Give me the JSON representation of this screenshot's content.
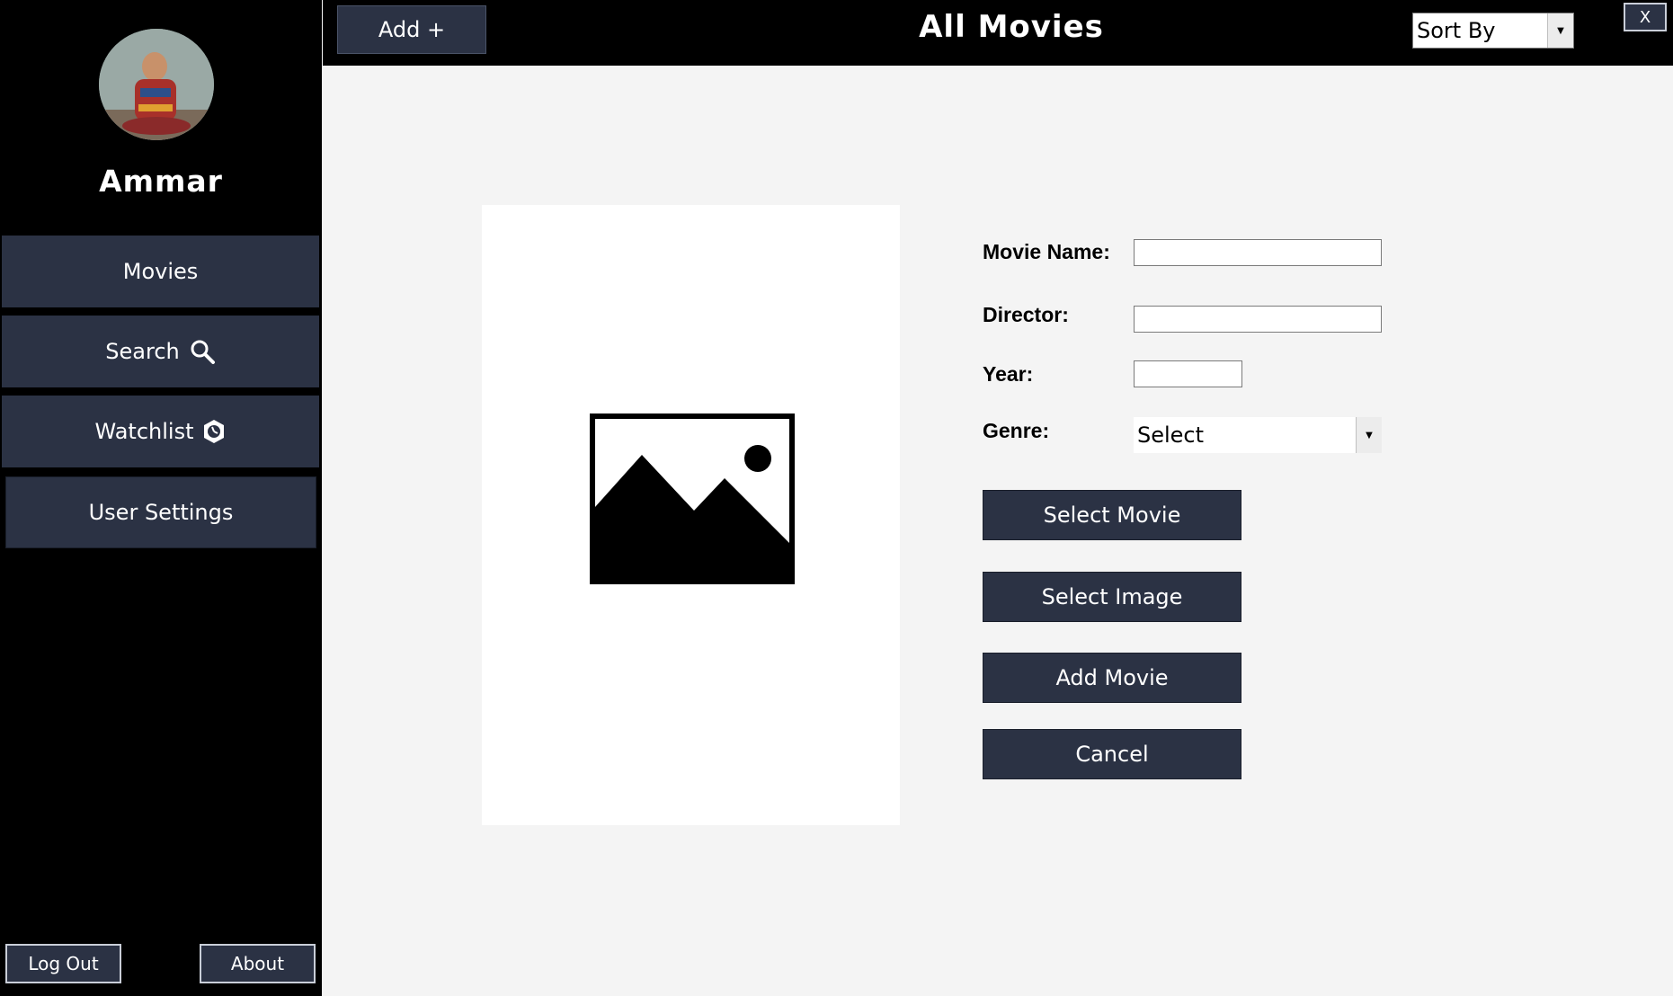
{
  "sidebar": {
    "username": "Ammar",
    "nav": {
      "movies": "Movies",
      "search": "Search",
      "watchlist": "Watchlist",
      "user_settings": "User Settings"
    },
    "logout": "Log Out",
    "about": "About"
  },
  "header": {
    "add_button": "Add +",
    "title": "All Movies",
    "sort_by": "Sort By",
    "close": "X"
  },
  "form": {
    "movie_name_label": "Movie Name:",
    "director_label": "Director:",
    "year_label": "Year:",
    "genre_label": "Genre:",
    "genre_value": "Select",
    "movie_name_value": "",
    "director_value": "",
    "year_value": "",
    "select_movie": "Select Movie",
    "select_image": "Select Image",
    "add_movie": "Add Movie",
    "cancel": "Cancel"
  },
  "colors": {
    "sidebar_bg": "#000000",
    "button_bg": "#2b3244",
    "main_bg": "#f4f4f4"
  },
  "icons": {
    "search": "search-icon",
    "watchlist": "watchlist-icon",
    "poster": "image-placeholder-icon",
    "dropdown": "chevron-down-icon"
  }
}
